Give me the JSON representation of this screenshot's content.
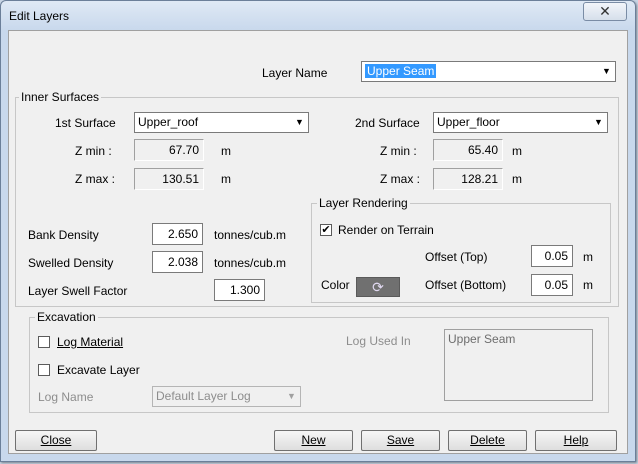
{
  "window": {
    "title": "Edit Layers",
    "close_glyph": "✕"
  },
  "layer_name": {
    "label": "Layer Name",
    "value": "Upper Seam"
  },
  "inner_surfaces": {
    "title": "Inner Surfaces",
    "first": {
      "label": "1st Surface",
      "value": "Upper_roof",
      "zmin_label": "Z min :",
      "zmin": "67.70",
      "zmax_label": "Z max :",
      "zmax": "130.51",
      "unit": "m"
    },
    "second": {
      "label": "2nd Surface",
      "value": "Upper_floor",
      "zmin_label": "Z min :",
      "zmin": "65.40",
      "zmax_label": "Z max :",
      "zmax": "128.21",
      "unit": "m"
    },
    "bank_density": {
      "label": "Bank Density",
      "value": "2.650",
      "unit": "tonnes/cub.m"
    },
    "swelled_density": {
      "label": "Swelled Density",
      "value": "2.038",
      "unit": "tonnes/cub.m"
    },
    "swell_factor": {
      "label": "Layer Swell Factor",
      "value": "1.300"
    }
  },
  "layer_rendering": {
    "title": "Layer Rendering",
    "render_on_terrain": {
      "label": "Render on Terrain",
      "checked": true,
      "mark": "✔"
    },
    "offset_top": {
      "label": "Offset (Top)",
      "value": "0.05",
      "unit": "m"
    },
    "offset_bottom": {
      "label": "Offset (Bottom)",
      "value": "0.05",
      "unit": "m"
    },
    "color": {
      "label": "Color",
      "icon": "palette-icon",
      "glyph": "⟳"
    }
  },
  "excavation": {
    "title": "Excavation",
    "log_material": {
      "label": "Log Material",
      "checked": false
    },
    "excavate_layer": {
      "label": "Excavate Layer",
      "checked": false
    },
    "log_used_in_label": "Log Used In",
    "log_used_in_items": [
      "Upper Seam"
    ],
    "log_name": {
      "label": "Log Name",
      "value": "Default Layer Log"
    }
  },
  "buttons": {
    "close": "Close",
    "new": "New",
    "save": "Save",
    "delete": "Delete",
    "help": "Help"
  },
  "arrow_glyph": "▼"
}
